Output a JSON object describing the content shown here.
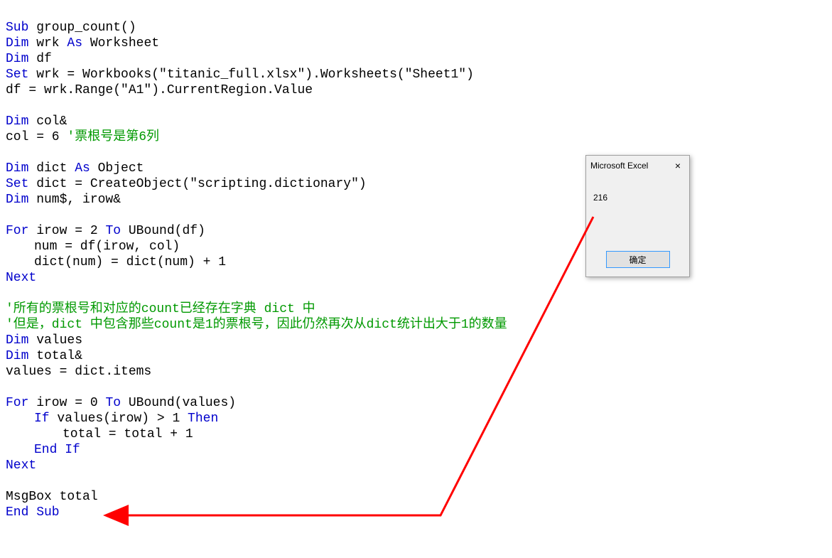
{
  "code": {
    "l1_kw_sub": "Sub",
    "l1_name": " group_count()",
    "l2_kw_dim": "Dim",
    "l2_var": " wrk ",
    "l2_kw_as": "As",
    "l2_type": " Worksheet",
    "l3_kw_dim": "Dim",
    "l3_var": " df",
    "l4_kw_set": "Set",
    "l4_rest": " wrk = Workbooks(\"titanic_full.xlsx\").Worksheets(\"Sheet1\")",
    "l5": "df = wrk.Range(\"A1\").CurrentRegion.Value",
    "l7_kw_dim": "Dim",
    "l7_var": " col&",
    "l8_a": "col = 6 ",
    "l8_cm": "'票根号是第6列",
    "l10_kw_dim": "Dim",
    "l10_var": " dict ",
    "l10_kw_as": "As",
    "l10_type": " Object",
    "l11_kw_set": "Set",
    "l11_rest": " dict = CreateObject(\"scripting.dictionary\")",
    "l12_kw_dim": "Dim",
    "l12_var": " num$, irow&",
    "l14_kw_for": "For",
    "l14_a": " irow = 2 ",
    "l14_kw_to": "To",
    "l14_b": " UBound(df)",
    "l15": "num = df(irow, col)",
    "l16": "dict(num) = dict(num) + 1",
    "l17_kw_next": "Next",
    "l19_cm": "'所有的票根号和对应的count已经存在字典 dict 中",
    "l20_cm": "'但是，dict 中包含那些count是1的票根号，因此仍然再次从dict统计出大于1的数量",
    "l21_kw_dim": "Dim",
    "l21_var": " values",
    "l22_kw_dim": "Dim",
    "l22_var": " total&",
    "l23": "values = dict.items",
    "l25_kw_for": "For",
    "l25_a": " irow = 0 ",
    "l25_kw_to": "To",
    "l25_b": " UBound(values)",
    "l26_kw_if": "If",
    "l26_a": " values(irow) > 1 ",
    "l26_kw_then": "Then",
    "l27": "total = total + 1",
    "l28_kw_endif": "End If",
    "l29_kw_next": "Next",
    "l31": "MsgBox total",
    "l32_kw_endsub": "End Sub"
  },
  "dialog": {
    "title": "Microsoft Excel",
    "value": "216",
    "ok_button": "确定"
  }
}
